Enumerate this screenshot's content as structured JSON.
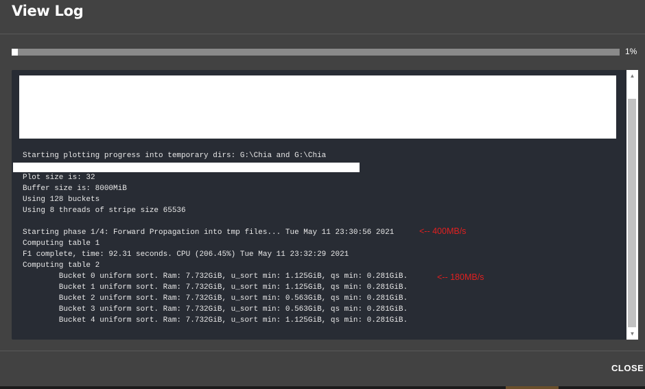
{
  "dialog": {
    "title": "View Log",
    "close_label": "CLOSE"
  },
  "progress": {
    "value_pct": 1,
    "label": "1%"
  },
  "log": {
    "lines": [
      "Starting plotting progress into temporary dirs: G:\\Chia and G:\\Chia",
      "Plot size is: 32",
      "Buffer size is: 8000MiB",
      "Using 128 buckets",
      "Using 8 threads of stripe size 65536",
      "Starting phase 1/4: Forward Propagation into tmp files... Tue May 11 23:30:56 2021",
      "Computing table 1",
      "F1 complete, time: 92.31 seconds. CPU (206.45%) Tue May 11 23:32:29 2021",
      "Computing table 2",
      "        Bucket 0 uniform sort. Ram: 7.732GiB, u_sort min: 1.125GiB, qs min: 0.281GiB.",
      "        Bucket 1 uniform sort. Ram: 7.732GiB, u_sort min: 1.125GiB, qs min: 0.281GiB.",
      "        Bucket 2 uniform sort. Ram: 7.732GiB, u_sort min: 0.563GiB, qs min: 0.281GiB.",
      "        Bucket 3 uniform sort. Ram: 7.732GiB, u_sort min: 0.563GiB, qs min: 0.281GiB.",
      "        Bucket 4 uniform sort. Ram: 7.732GiB, u_sort min: 1.125GiB, qs min: 0.281GiB."
    ],
    "annotations": [
      "<-- 400MB/s",
      "<-- 180MB/s"
    ]
  },
  "colors": {
    "dialog_bg": "#424242",
    "log_bg": "#282c34",
    "log_text": "#e8e8e8",
    "annotation": "#e02020",
    "progress_track": "#8a8a8a",
    "progress_fill": "#ffffff"
  },
  "icons": {
    "scroll_up": "scroll-up-arrow-icon",
    "scroll_down": "scroll-down-arrow-icon"
  }
}
